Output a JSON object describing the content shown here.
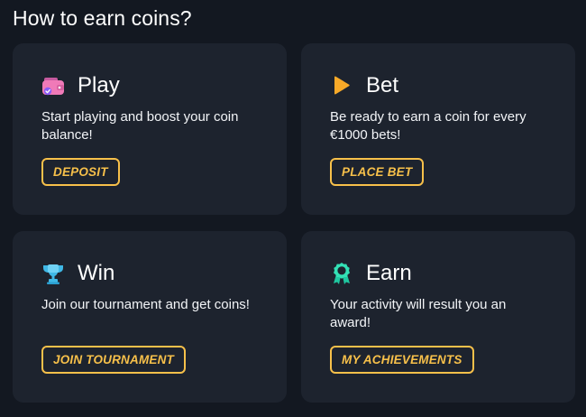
{
  "heading": "How to earn coins?",
  "colors": {
    "background": "#131821",
    "card": "#1d232e",
    "accent": "#f7c04a"
  },
  "cards": [
    {
      "icon": "wallet-icon",
      "title": "Play",
      "description": "Start playing and boost your coin balance!",
      "button": "DEPOSIT"
    },
    {
      "icon": "play-icon",
      "title": "Bet",
      "description": "Be ready to earn a coin for every €1000 bets!",
      "button": "PLACE BET"
    },
    {
      "icon": "trophy-icon",
      "title": "Win",
      "description": "Join our tournament and get coins!",
      "button": "JOIN TOURNAMENT"
    },
    {
      "icon": "award-icon",
      "title": "Earn",
      "description": "Your activity will result you an award!",
      "button": "MY ACHIEVEMENTS"
    }
  ]
}
